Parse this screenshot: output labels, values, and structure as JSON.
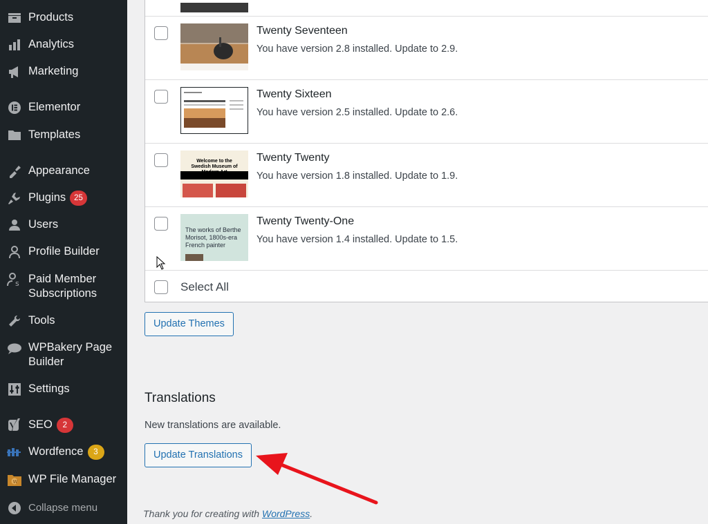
{
  "sidebar": {
    "items": [
      {
        "label": "Products",
        "icon": "products-icon"
      },
      {
        "label": "Analytics",
        "icon": "analytics-icon"
      },
      {
        "label": "Marketing",
        "icon": "marketing-icon"
      },
      {
        "label": "Elementor",
        "icon": "elementor-icon"
      },
      {
        "label": "Templates",
        "icon": "templates-icon"
      },
      {
        "label": "Appearance",
        "icon": "appearance-icon"
      },
      {
        "label": "Plugins",
        "icon": "plugins-icon",
        "badge": "25"
      },
      {
        "label": "Users",
        "icon": "users-icon"
      },
      {
        "label": "Profile Builder",
        "icon": "profile-builder-icon"
      },
      {
        "label": "Paid Member Subscriptions",
        "icon": "paid-member-icon"
      },
      {
        "label": "Tools",
        "icon": "tools-icon"
      },
      {
        "label": "WPBakery Page Builder",
        "icon": "wpbakery-icon"
      },
      {
        "label": "Settings",
        "icon": "settings-icon"
      },
      {
        "label": "SEO",
        "icon": "seo-icon",
        "badge": "2"
      },
      {
        "label": "Wordfence",
        "icon": "wordfence-icon",
        "badge": "3"
      },
      {
        "label": "WP File Manager",
        "icon": "wp-file-manager-icon"
      }
    ],
    "collapse_label": "Collapse menu"
  },
  "themes": [
    {
      "name": "Twenty Seventeen",
      "desc": "You have version 2.8 installed. Update to 2.9."
    },
    {
      "name": "Twenty Sixteen",
      "desc": "You have version 2.5 installed. Update to 2.6."
    },
    {
      "name": "Twenty Twenty",
      "desc": "You have version 1.8 installed. Update to 1.9.",
      "thumb_heading": "Welcome to the Swedish Museum of Modern Art"
    },
    {
      "name": "Twenty Twenty-One",
      "desc": "You have version 1.4 installed. Update to 1.5.",
      "thumb_heading": "The works of Berthe Morisot, 1800s-era French painter"
    }
  ],
  "select_all_label": "Select All",
  "update_themes_label": "Update Themes",
  "translations": {
    "heading": "Translations",
    "notice": "New translations are available.",
    "button_label": "Update Translations"
  },
  "footer": {
    "text": "Thank you for creating with ",
    "link": "WordPress",
    "suffix": "."
  },
  "colors": {
    "sidebar_bg": "#1d2327",
    "accent": "#2271b1",
    "badge_red": "#d63638",
    "badge_yellow": "#dba617",
    "arrow": "#e8141c"
  }
}
